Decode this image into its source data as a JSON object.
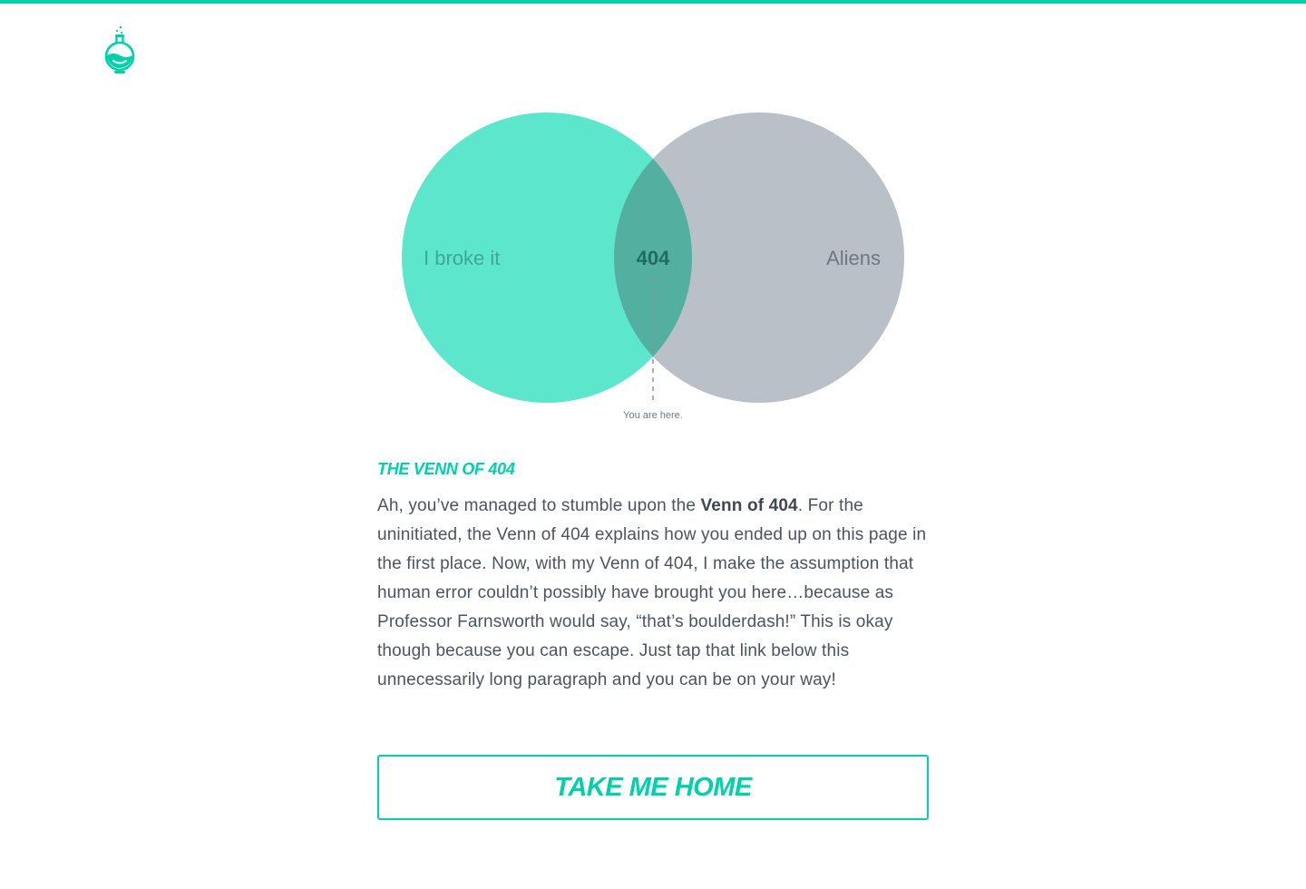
{
  "brand": {
    "accent_color": "#00d1ab",
    "logo_icon": "flask-icon"
  },
  "venn": {
    "left_label": "I broke it",
    "right_label": "Aliens",
    "intersection_label": "404",
    "pointer_label": "You are here.",
    "left_color": "#5ce7cd",
    "right_color": "#b9c0c8",
    "intersection_color": "#53b0a1"
  },
  "article": {
    "title": "THE VENN OF 404",
    "paragraph_part1": "Ah, you’ve managed to stumble upon the ",
    "paragraph_bold": "Venn of 404",
    "paragraph_part2": ". For the uninitiated, the Venn of 404 explains how you ended up on this page in the first place. Now, with my Venn of 404, I make the assumption that human error couldn’t possibly have brought you here…because as Professor Farnsworth would say, “that’s boulderdash!” This is okay though because you can escape. Just tap that link below this unnecessarily long paragraph and you can be on your way!"
  },
  "cta": {
    "label": "TAKE ME HOME"
  }
}
